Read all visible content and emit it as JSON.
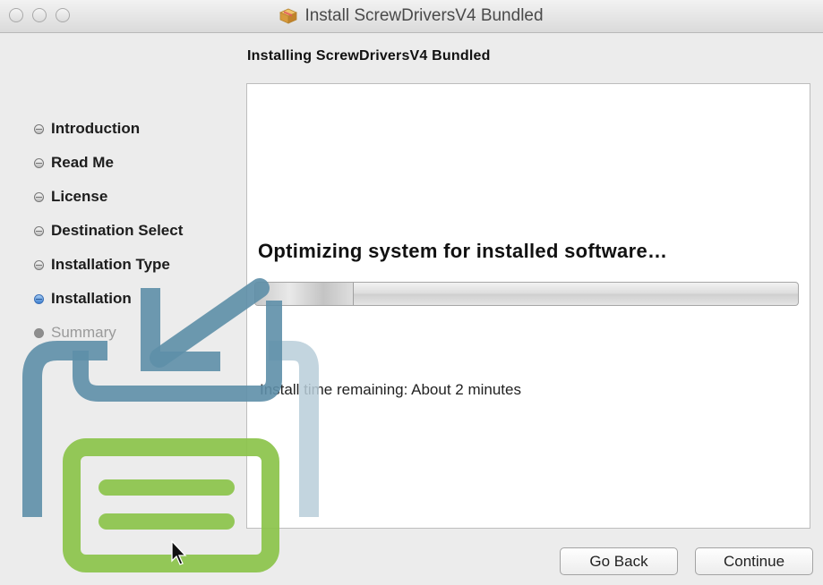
{
  "window": {
    "title": "Install ScrewDriversV4 Bundled",
    "title_icon": "package-icon"
  },
  "header": {
    "subtitle": "Installing ScrewDriversV4 Bundled"
  },
  "sidebar": {
    "items": [
      {
        "label": "Introduction",
        "state": "done"
      },
      {
        "label": "Read Me",
        "state": "done"
      },
      {
        "label": "License",
        "state": "done"
      },
      {
        "label": "Destination Select",
        "state": "done"
      },
      {
        "label": "Installation Type",
        "state": "done"
      },
      {
        "label": "Installation",
        "state": "current"
      },
      {
        "label": "Summary",
        "state": "pending"
      }
    ]
  },
  "main": {
    "status": "Optimizing system for installed software…",
    "progress_percent": 18,
    "time_remaining": "Install time remaining: About 2 minutes"
  },
  "buttons": {
    "back_label": "Go Back",
    "continue_label": "Continue"
  },
  "colors": {
    "overlay_blue": "#5e8fa8",
    "overlay_light_blue": "#b9ced9",
    "overlay_green": "#8bc34a",
    "current_step_blue": "#3d7fcf"
  }
}
